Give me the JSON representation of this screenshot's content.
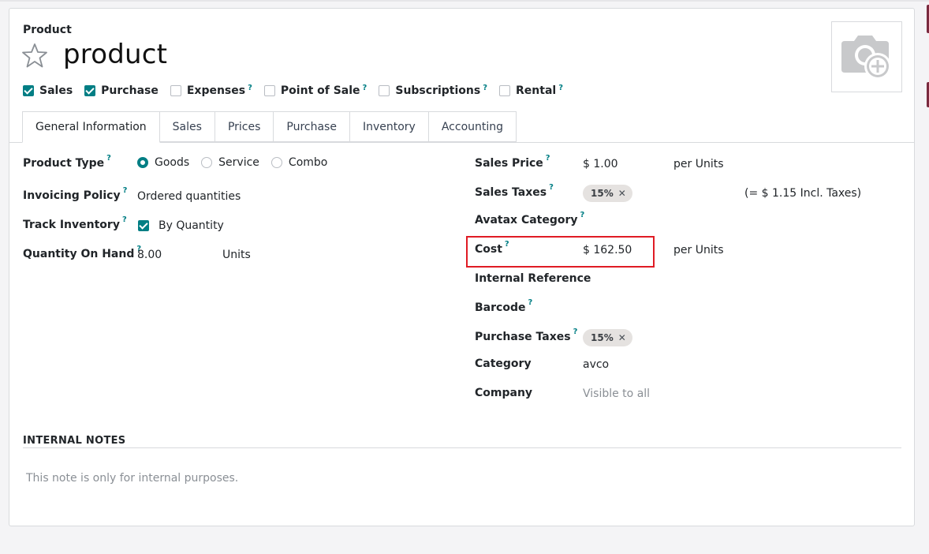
{
  "header": {
    "model_label": "Product",
    "product_name": "product"
  },
  "options": [
    {
      "label": "Sales",
      "checked": true,
      "help": ""
    },
    {
      "label": "Purchase",
      "checked": true,
      "help": ""
    },
    {
      "label": "Expenses",
      "checked": false,
      "help": "?"
    },
    {
      "label": "Point of Sale",
      "checked": false,
      "help": "?"
    },
    {
      "label": "Subscriptions",
      "checked": false,
      "help": "?"
    },
    {
      "label": "Rental",
      "checked": false,
      "help": "?"
    }
  ],
  "tabs": [
    "General Information",
    "Sales",
    "Prices",
    "Purchase",
    "Inventory",
    "Accounting"
  ],
  "left": {
    "product_type": {
      "label": "Product Type",
      "help": "?",
      "options": [
        "Goods",
        "Service",
        "Combo"
      ],
      "selected": "Goods"
    },
    "invoicing_policy": {
      "label": "Invoicing Policy",
      "help": "?",
      "value": "Ordered quantities"
    },
    "track_inventory": {
      "label": "Track Inventory",
      "help": "?",
      "value": "By Quantity",
      "checked": true
    },
    "qty_on_hand": {
      "label": "Quantity On Hand",
      "help": "?",
      "value": "8.00",
      "uom": "Units"
    }
  },
  "right": {
    "sales_price": {
      "label": "Sales Price",
      "help": "?",
      "value": "$ 1.00",
      "per": "per Units"
    },
    "sales_taxes": {
      "label": "Sales Taxes",
      "help": "?",
      "tag": "15%",
      "tag_x": "✕",
      "incl": "(= $ 1.15 Incl. Taxes)"
    },
    "avatax_category": {
      "label": "Avatax Category",
      "help": "?"
    },
    "cost": {
      "label": "Cost",
      "help": "?",
      "value": "$ 162.50",
      "per": "per Units"
    },
    "internal_reference": {
      "label": "Internal Reference"
    },
    "barcode": {
      "label": "Barcode",
      "help": "?"
    },
    "purchase_taxes": {
      "label": "Purchase Taxes",
      "help": "?",
      "tag": "15%",
      "tag_x": "✕"
    },
    "category": {
      "label": "Category",
      "value": "avco"
    },
    "company": {
      "label": "Company",
      "value": "Visible to all"
    }
  },
  "notes": {
    "heading": "INTERNAL NOTES",
    "placeholder": "This note is only for internal purposes."
  },
  "colors": {
    "accent": "#017e84",
    "highlight": "#e01b24"
  },
  "icons": [
    "star-icon",
    "camera-plus-icon",
    "checkbox-icon",
    "radio-icon",
    "close-icon"
  ]
}
